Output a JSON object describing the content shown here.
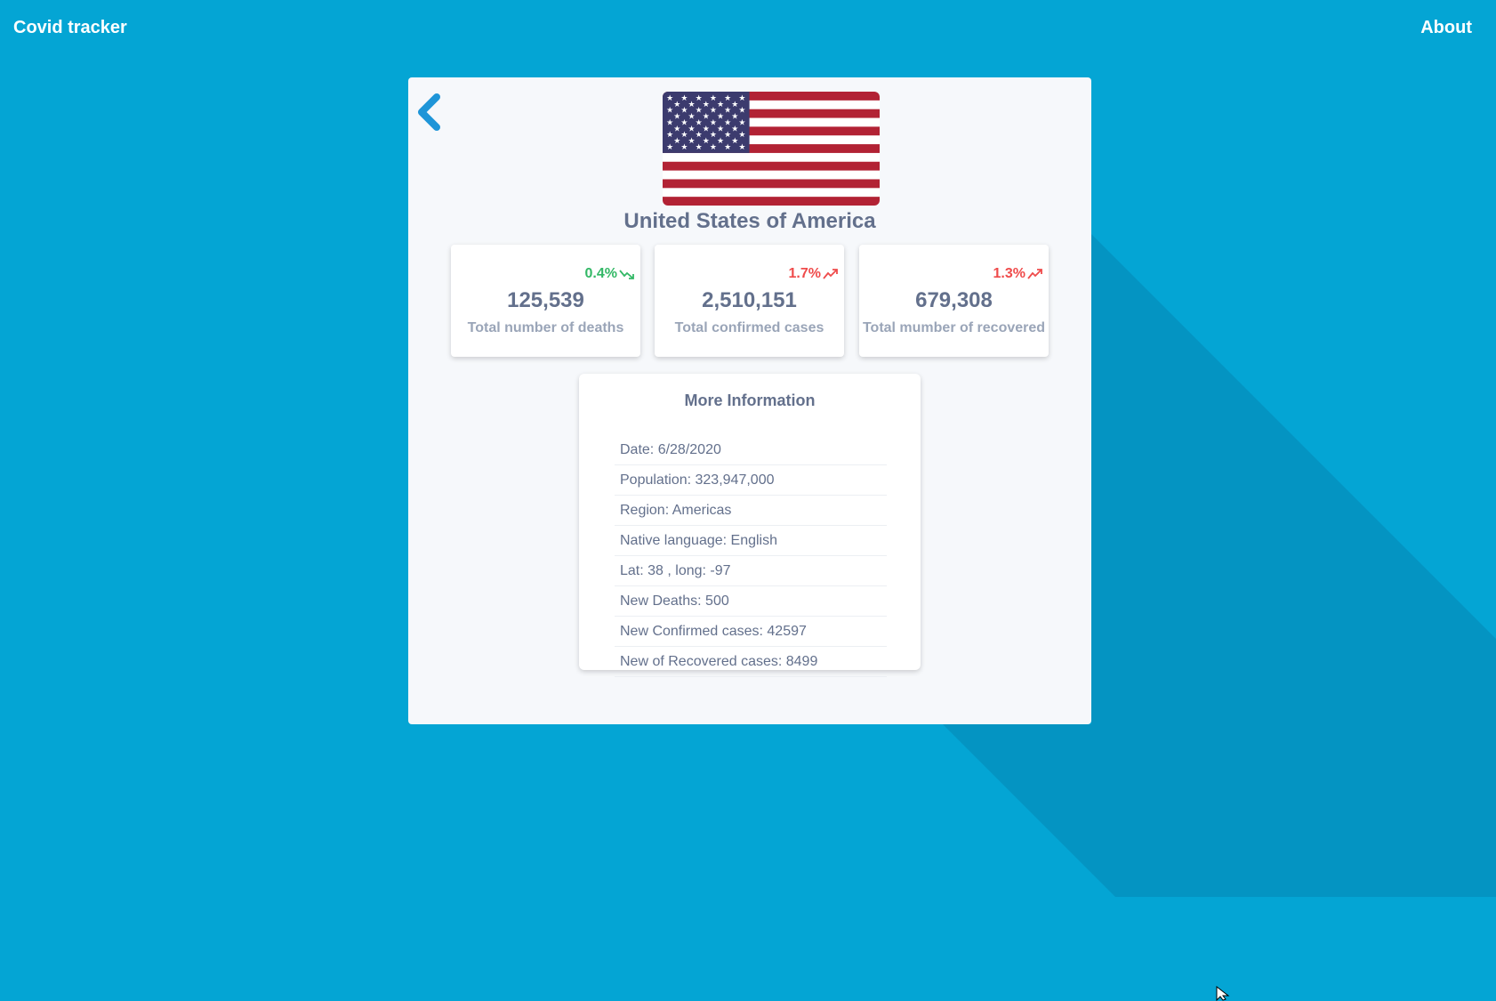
{
  "nav": {
    "brand": "Covid tracker",
    "about": "About"
  },
  "country": {
    "name": "United States of America",
    "flag_icon": "usa-flag"
  },
  "stats": [
    {
      "change": "0.4%",
      "trend": "down",
      "trend_color": "#33b866",
      "value": "125,539",
      "label": "Total number of deaths"
    },
    {
      "change": "1.7%",
      "trend": "up",
      "trend_color": "#ef4b4b",
      "value": "2,510,151",
      "label": "Total confirmed cases"
    },
    {
      "change": "1.3%",
      "trend": "up",
      "trend_color": "#ef4b4b",
      "value": "679,308",
      "label": "Total mumber of recovered"
    }
  ],
  "info": {
    "title": "More Information",
    "items": [
      "Date: 6/28/2020",
      "Population: 323,947,000",
      "Region: Americas",
      "Native language: English",
      "Lat: 38 , long: -97",
      "New Deaths: 500",
      "New Confirmed cases: 42597",
      "New of Recovered cases: 8499"
    ]
  },
  "colors": {
    "background": "#04a5d4",
    "panel": "#f6f8fb",
    "accent": "#1e95d8",
    "text": "#63708c"
  }
}
